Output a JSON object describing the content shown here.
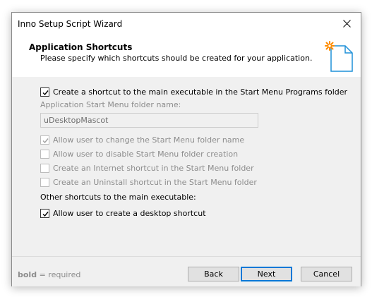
{
  "window": {
    "title": "Inno Setup Script Wizard"
  },
  "header": {
    "title": "Application Shortcuts",
    "subtitle": "Please specify which shortcuts should be created for your application.",
    "icon": "new-document-sparkle-icon"
  },
  "form": {
    "create_start_menu_shortcut": {
      "label": "Create a shortcut to the main executable in the Start Menu Programs folder",
      "checked": true,
      "enabled": true
    },
    "folder_name_label": "Application Start Menu folder name:",
    "folder_name_value": "uDesktopMascot",
    "allow_change_folder": {
      "label": "Allow user to change the Start Menu folder name",
      "checked": true,
      "enabled": false
    },
    "allow_disable_folder": {
      "label": "Allow user to disable Start Menu folder creation",
      "checked": false,
      "enabled": false
    },
    "internet_shortcut": {
      "label": "Create an Internet shortcut in the Start Menu folder",
      "checked": false,
      "enabled": false
    },
    "uninstall_shortcut": {
      "label": "Create an Uninstall shortcut in the Start Menu folder",
      "checked": false,
      "enabled": false
    },
    "other_shortcuts_label": "Other shortcuts to the main executable:",
    "desktop_shortcut": {
      "label": "Allow user to create a desktop shortcut",
      "checked": true,
      "enabled": true
    }
  },
  "footer": {
    "required_bold": "bold",
    "required_suffix": " = required",
    "back_label": "Back",
    "next_label": "Next",
    "cancel_label": "Cancel"
  },
  "colors": {
    "accent": "#0078d7",
    "icon_orange": "#ff8c00",
    "icon_blue": "#1e90d8"
  }
}
